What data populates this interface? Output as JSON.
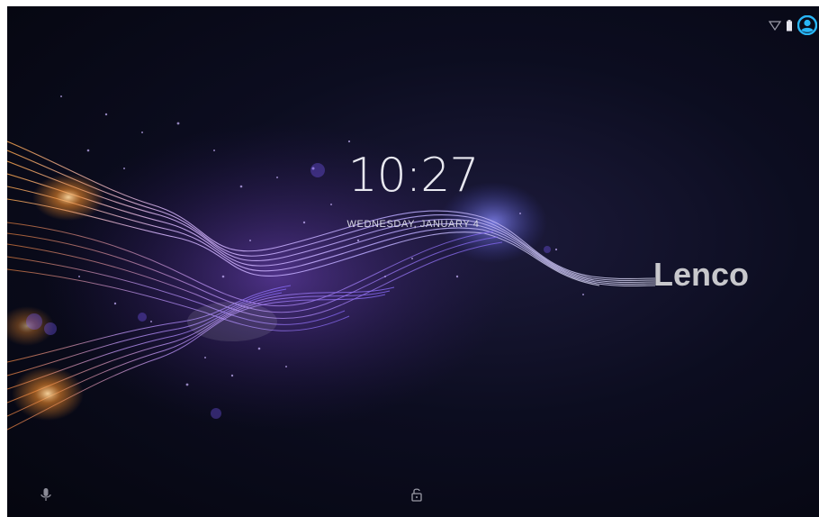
{
  "lockscreen": {
    "time": "10:27",
    "date": "WEDNESDAY, JANUARY 4",
    "brand_logo": "Lenco"
  },
  "status_bar": {
    "icons": [
      "wifi-icon",
      "battery-icon",
      "user-account-icon"
    ],
    "accent_color": "#29b6f6"
  },
  "bottom_bar": {
    "icons": [
      "microphone-icon",
      "lock-icon"
    ]
  }
}
